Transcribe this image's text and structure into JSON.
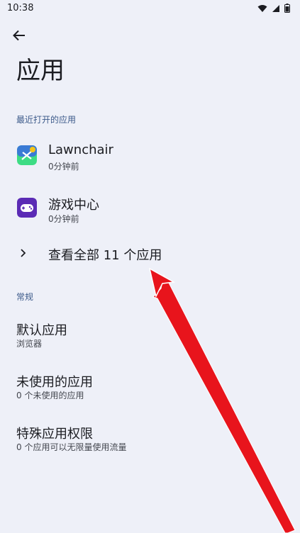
{
  "status_bar": {
    "time": "10:38",
    "icons": [
      "wifi-icon",
      "signal-icon",
      "battery-icon"
    ]
  },
  "header": {
    "title": "应用"
  },
  "recent": {
    "header": "最近打开的应用",
    "apps": [
      {
        "name": "Lawnchair",
        "sub": "0分钟前",
        "icon": "lawnchair-icon"
      },
      {
        "name": "游戏中心",
        "sub": "0分钟前",
        "icon": "game-center-icon"
      }
    ],
    "see_all": "查看全部 11 个应用"
  },
  "general": {
    "header": "常规",
    "items": [
      {
        "title": "默认应用",
        "sub": "浏览器"
      },
      {
        "title": "未使用的应用",
        "sub": "0 个未使用的应用"
      },
      {
        "title": "特殊应用权限",
        "sub": "0 个应用可以无限量使用流量"
      }
    ]
  },
  "colors": {
    "background": "#eef0f8",
    "section_header": "#3c5a8a",
    "annotation_arrow": "#e8141c"
  }
}
